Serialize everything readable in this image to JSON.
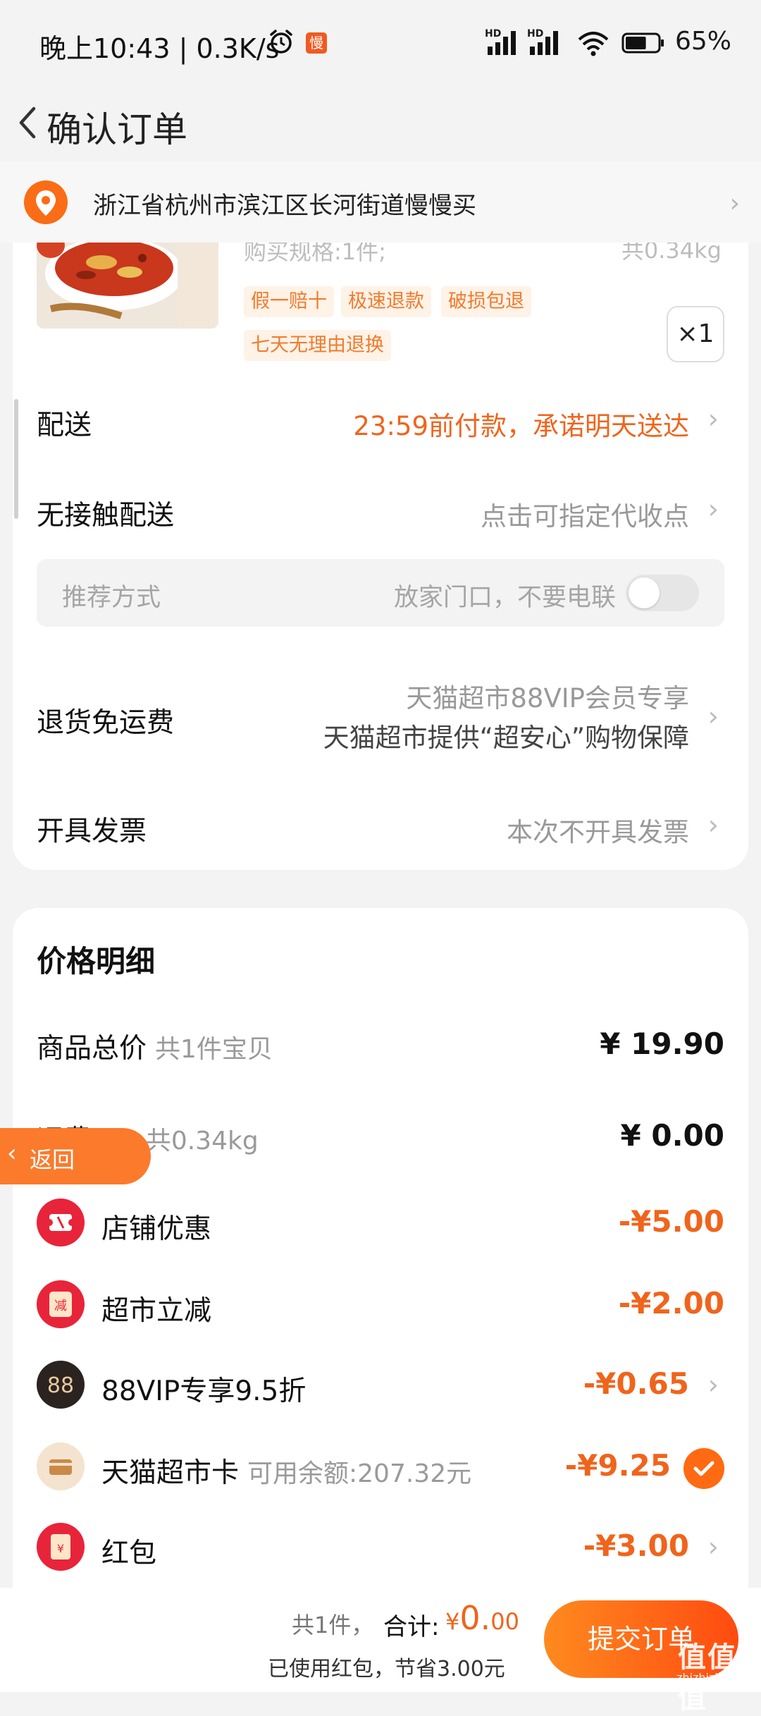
{
  "status_bar": {
    "time": "晚上10:43 | 0.3K/s",
    "app_badge": "慢",
    "hd1": "HD",
    "hd2": "HD",
    "battery": "65%",
    "battery_level": 0.65
  },
  "header": {
    "title": "确认订单"
  },
  "address": {
    "text": "浙江省杭州市滨江区长河街道慢慢买"
  },
  "product": {
    "spec": "购买规格:1件;",
    "weight": "共0.34kg",
    "tags": [
      "假一赔十",
      "极速退款",
      "破损包退",
      "七天无理由退换"
    ],
    "quantity": "×1"
  },
  "rows": {
    "delivery_label": "配送",
    "delivery_value": "23:59前付款，承诺明天送达",
    "contactless_label": "无接触配送",
    "contactless_value": "点击可指定代收点",
    "recommend_label": "推荐方式",
    "recommend_value": "放家门口，不要电联",
    "return_label": "退货免运费",
    "return_value_1": "天猫超市88VIP会员专享",
    "return_value_2": "天猫超市提供“超安心”购物保障",
    "invoice_label": "开具发票",
    "invoice_value": "本次不开具发票"
  },
  "price_detail": {
    "title": "价格明细",
    "goods_label": "商品总价",
    "goods_sub": "共1件宝贝",
    "goods_amount": "¥ 19.90",
    "shipping_label": "运费",
    "shipping_sub": "共0.34kg",
    "shipping_amount": "¥ 0.00",
    "discounts": [
      {
        "label": "店铺优惠",
        "sub": "",
        "amount": "-¥5.00",
        "icon": "ticket-icon"
      },
      {
        "label": "超市立减",
        "sub": "",
        "amount": "-¥2.00",
        "icon": "jian-icon"
      },
      {
        "label": "88VIP专享9.5折",
        "sub": "",
        "amount": "-¥0.65",
        "icon": "88vip-icon"
      },
      {
        "label": "天猫超市卡",
        "sub": "可用余额:207.32元",
        "amount": "-¥9.25",
        "icon": "card-icon"
      },
      {
        "label": "红包",
        "sub": "",
        "amount": "-¥3.00",
        "icon": "red-packet-icon"
      }
    ]
  },
  "float_back": {
    "label": "返回"
  },
  "bottom": {
    "count": "共1件，",
    "total_label": "合计:",
    "total_currency": "¥",
    "total_value": "0.",
    "total_decimals": "00",
    "saved": "已使用红包，节省3.00元",
    "submit": "提交订单"
  },
  "watermark": {
    "text": "值值值",
    "sub": "zhizhizhi.com"
  },
  "colors": {
    "accent": "#f0641c",
    "submit_start": "#ff8a1f",
    "submit_end": "#ff4b10"
  }
}
